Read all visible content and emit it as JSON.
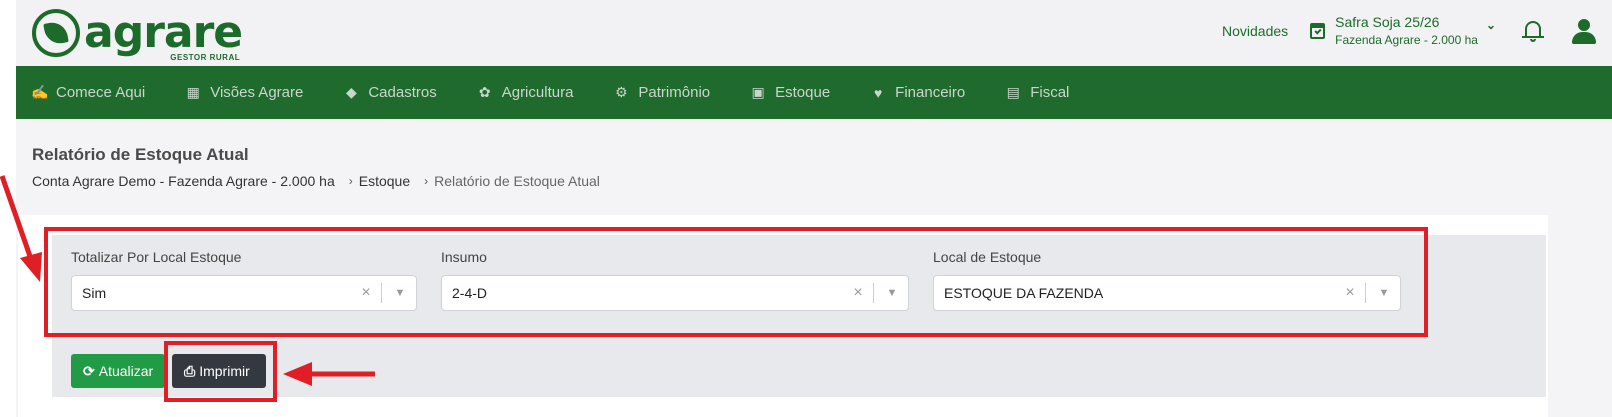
{
  "header": {
    "logo_text": "agrare",
    "logo_sub": "GESTOR RURAL",
    "novidades": "Novidades",
    "safra_title": "Safra Soja 25/26",
    "safra_farm": "Fazenda Agrare - 2.000 ha"
  },
  "nav": {
    "items": [
      {
        "label": "Comece Aqui",
        "icon": "handshake-icon"
      },
      {
        "label": "Visões Agrare",
        "icon": "dashboard-icon"
      },
      {
        "label": "Cadastros",
        "icon": "tags-icon"
      },
      {
        "label": "Agricultura",
        "icon": "leaf-icon"
      },
      {
        "label": "Patrimônio",
        "icon": "tractor-icon"
      },
      {
        "label": "Estoque",
        "icon": "boxes-icon"
      },
      {
        "label": "Financeiro",
        "icon": "hand-money-icon"
      },
      {
        "label": "Fiscal",
        "icon": "file-invoice-icon"
      }
    ]
  },
  "page": {
    "title": "Relatório de Estoque Atual",
    "breadcrumb": [
      "Conta Agrare Demo - Fazenda Agrare - 2.000 ha",
      "Estoque",
      "Relatório de Estoque Atual"
    ]
  },
  "filters": {
    "totalizar": {
      "label": "Totalizar Por Local Estoque",
      "value": "Sim"
    },
    "insumo": {
      "label": "Insumo",
      "value": "2-4-D"
    },
    "local": {
      "label": "Local de Estoque",
      "value": "ESTOQUE DA FAZENDA"
    }
  },
  "actions": {
    "update_label": "Atualizar",
    "print_label": "Imprimir"
  },
  "colors": {
    "brand_green": "#1f6b2d",
    "update_green": "#219b45",
    "print_dark": "#34393f",
    "annotation_red": "#e01e25"
  }
}
